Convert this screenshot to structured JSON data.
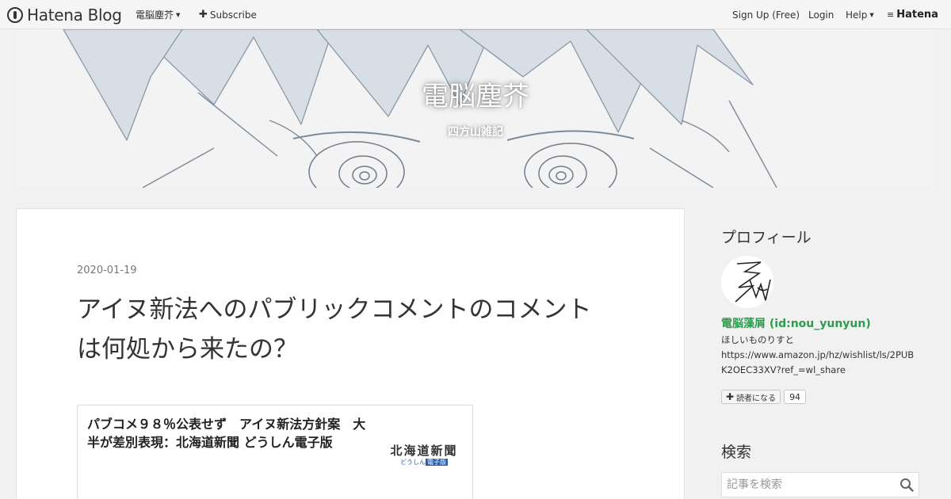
{
  "topbar": {
    "logo_text": "Hatena Blog",
    "blog_menu_label": "電脳塵芥",
    "subscribe_label": "Subscribe",
    "signup_label": "Sign Up (Free)",
    "login_label": "Login",
    "help_label": "Help",
    "hatena_label": "Hatena"
  },
  "header": {
    "title": "電脳塵芥",
    "subtitle": "四方山雑記"
  },
  "entry": {
    "date": "2020-01-19",
    "title": "アイヌ新法へのパブリックコメントのコメントは何処から来たの？",
    "embed": {
      "title": "パブコメ９８％公表せず　アイヌ新法方針案　大半が差別表現：北海道新聞 どうしん電子版",
      "logo_main": "北海道新聞",
      "logo_sub_prefix": "どうしん",
      "logo_sub_emph": "電子版"
    }
  },
  "sidebar": {
    "profile_heading": "プロフィール",
    "profile_name": "電脳藻屑 (id:nou_yunyun)",
    "profile_desc_line1": "ほしいものりすと",
    "profile_desc_line2": "https://www.amazon.jp/hz/wishlist/ls/2PUBK2OEC33XV?ref_=wl_share",
    "follow_label": "読者になる",
    "follow_count": "94",
    "search_heading": "検索",
    "search_placeholder": "記事を検索"
  },
  "colors": {
    "profile_name": "#2e9c4e",
    "page_bg": "#f1f1f1"
  }
}
